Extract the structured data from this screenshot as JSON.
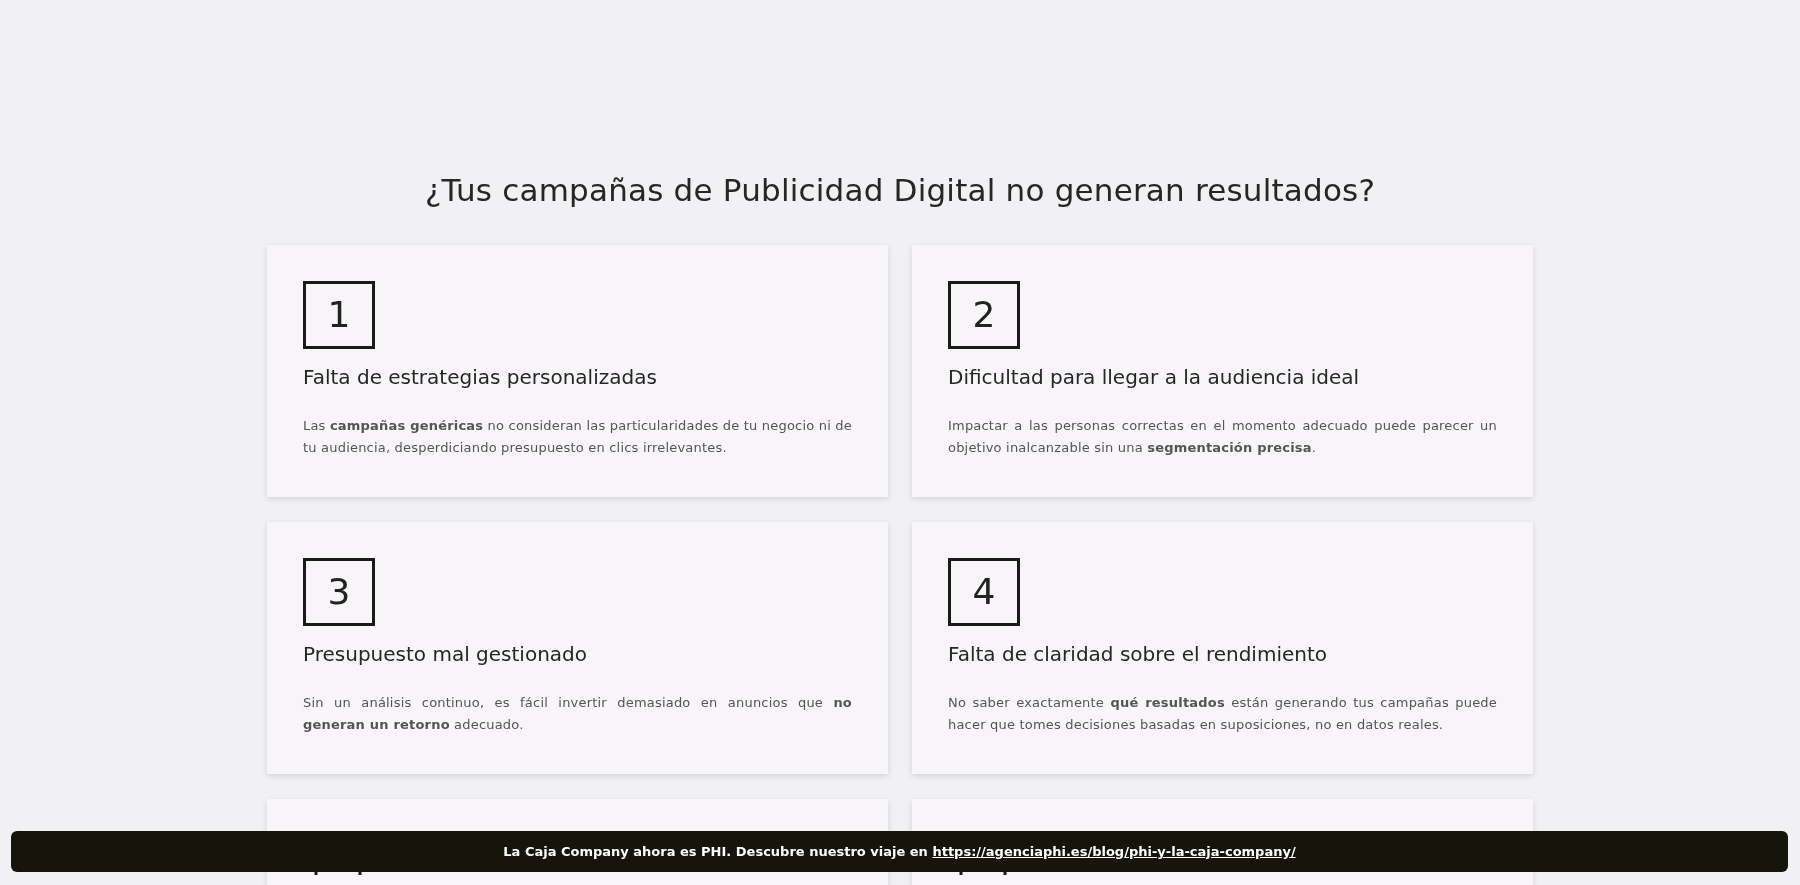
{
  "heading": "¿Tus campañas de Publicidad Digital no generan resultados?",
  "cards": [
    {
      "kind": "full",
      "number": "1",
      "title": "Falta de estrategias personalizadas",
      "body": "Las **campañas genéricas** no consideran las particularidades de tu negocio ni de tu audiencia, desperdiciando presupuesto en clics irrelevantes."
    },
    {
      "kind": "full",
      "number": "2",
      "title": "Dificultad para llegar a la audiencia ideal",
      "body": "Impactar a las personas correctas en el momento adecuado puede parecer un objetivo inalcanzable sin una **segmentación precisa**."
    },
    {
      "kind": "full",
      "number": "3",
      "title": "Presupuesto mal gestionado",
      "body": "Sin un análisis continuo, es fácil invertir demasiado en anuncios que **no generan un retorno** adecuado."
    },
    {
      "kind": "full",
      "number": "4",
      "title": "Falta de claridad sobre el rendimiento",
      "body": "No saber exactamente **qué resultados** están generando tus campañas puede hacer que tomes decisiones basadas en suposiciones, no en datos reales."
    },
    {
      "kind": "cut"
    },
    {
      "kind": "cut"
    }
  ],
  "banner": {
    "text": "La Caja Company ahora es PHI. Descubre nuestro viaje en",
    "link": "https://agenciaphi.es/blog/phi-y-la-caja-company/"
  }
}
